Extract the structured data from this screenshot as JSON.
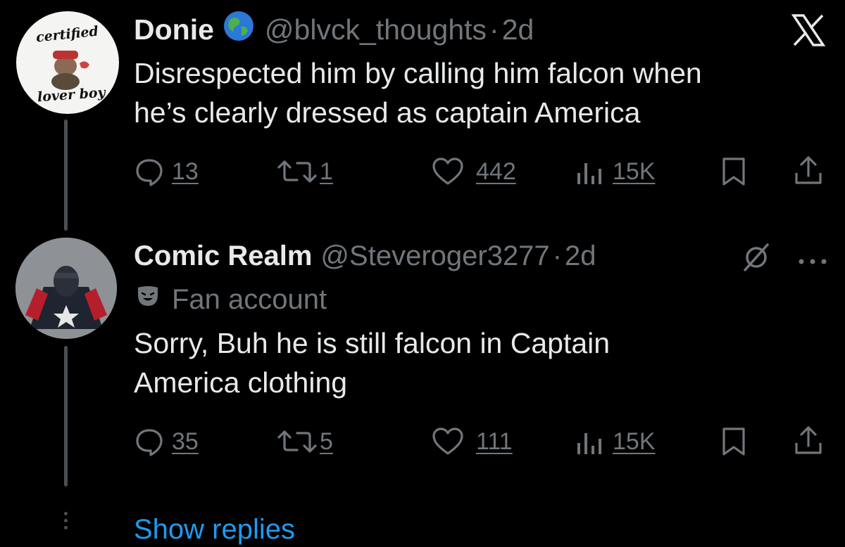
{
  "tweet1": {
    "avatar": {
      "top_text": "certified",
      "bottom_text": "lover boy"
    },
    "display_name": "Donie",
    "name_icon": "globe-emoji",
    "handle": "@blvck_thoughts",
    "sep": "·",
    "time": "2d",
    "platform_icon": "x-logo-icon",
    "text_line1": "Disrespected him by calling him falcon when",
    "text_line2": "he’s clearly dressed as captain America",
    "metrics": {
      "replies": "13",
      "reposts": "1",
      "likes": "442",
      "views": "15K"
    }
  },
  "tweet2": {
    "display_name": "Comic Realm",
    "handle": "@Steveroger3277",
    "sep": "·",
    "time": "2d",
    "label_icon": "theater-mask-icon",
    "label": "Fan account",
    "text_line1": "Sorry, Buh he is still falcon in Captain",
    "text_line2": "America clothing",
    "metrics": {
      "replies": "35",
      "reposts": "5",
      "likes": "111",
      "views": "15K"
    }
  },
  "show_replies": "Show replies",
  "colors": {
    "background": "#000000",
    "text": "#e7e9ea",
    "secondary": "#71767b",
    "link": "#1d9bf0"
  }
}
